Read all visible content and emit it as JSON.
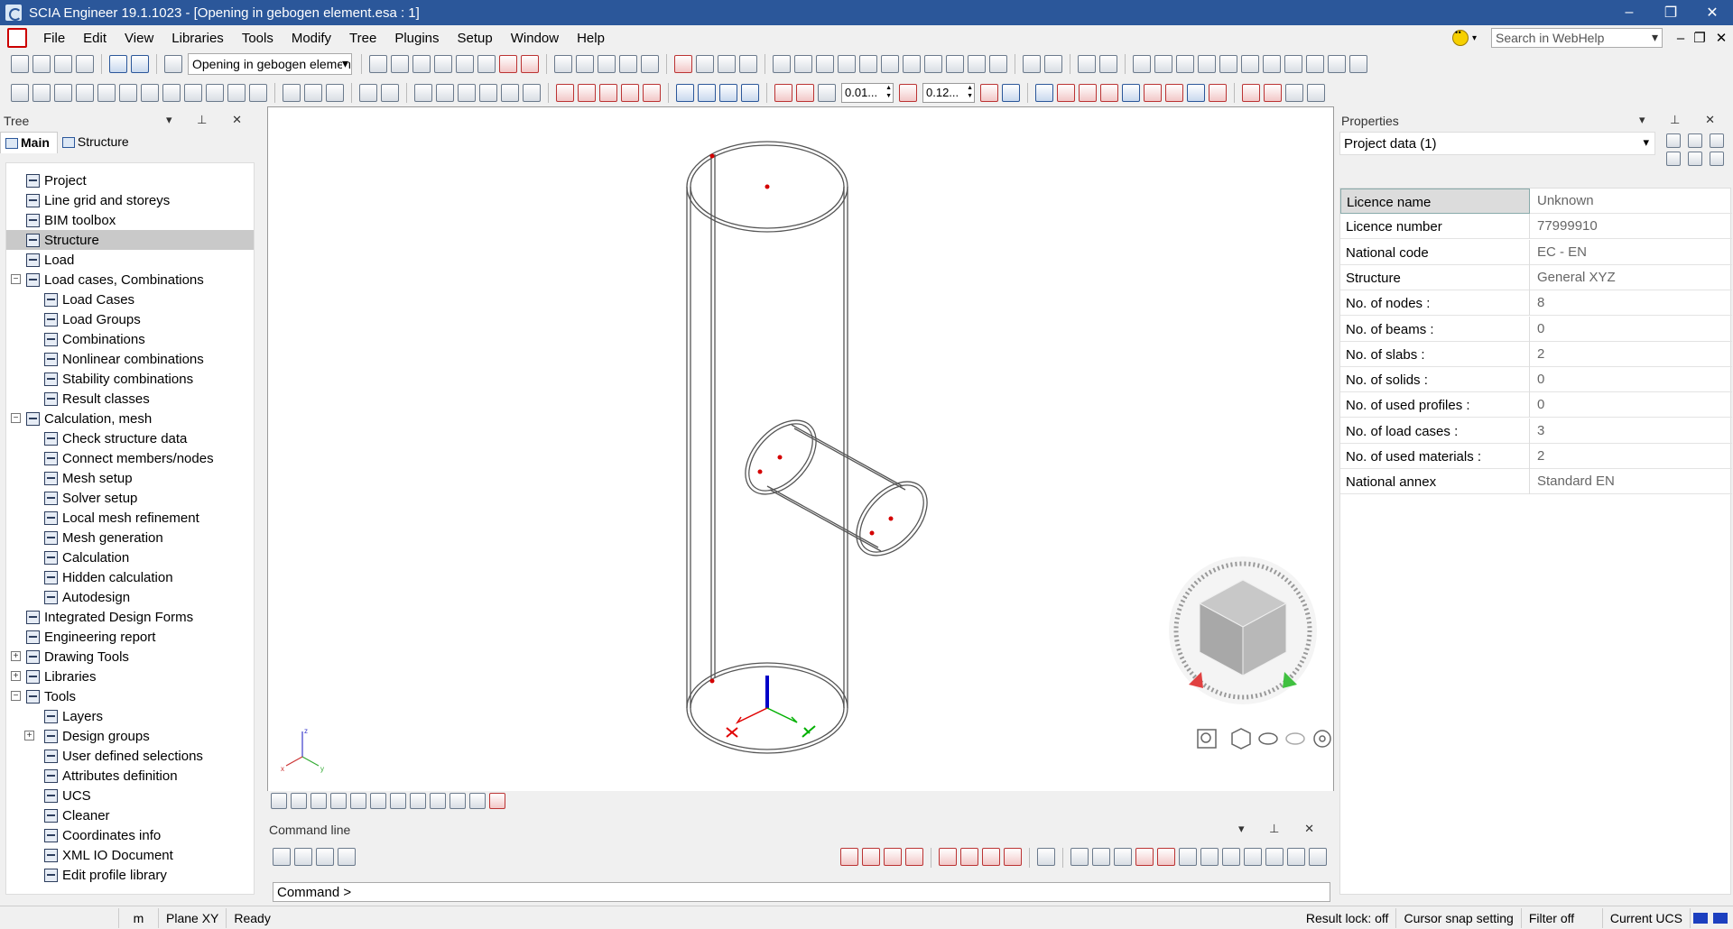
{
  "window": {
    "title": "SCIA Engineer 19.1.1023 - [Opening in gebogen element.esa : 1]",
    "minimize": "–",
    "restore": "❐",
    "close": "✕"
  },
  "menu": {
    "items": [
      "File",
      "Edit",
      "View",
      "Libraries",
      "Tools",
      "Modify",
      "Tree",
      "Plugins",
      "Setup",
      "Window",
      "Help"
    ],
    "search_placeholder": "Search in WebHelp",
    "mdi_min": "–",
    "mdi_restore": "❐",
    "mdi_close": "✕"
  },
  "toolbar": {
    "active_view": "Opening in gebogen element",
    "spin1": "0.01...",
    "spin2": "0.12..."
  },
  "tree_panel": {
    "title": "Tree",
    "tabs": [
      "Main",
      "Structure"
    ],
    "items": [
      {
        "label": "Project",
        "level": 1
      },
      {
        "label": "Line grid and storeys",
        "level": 1
      },
      {
        "label": "BIM toolbox",
        "level": 1
      },
      {
        "label": "Structure",
        "level": 1,
        "selected": true
      },
      {
        "label": "Load",
        "level": 1
      },
      {
        "label": "Load cases, Combinations",
        "level": 1,
        "expander": "−"
      },
      {
        "label": "Load Cases",
        "level": 2
      },
      {
        "label": "Load Groups",
        "level": 2
      },
      {
        "label": "Combinations",
        "level": 2
      },
      {
        "label": "Nonlinear combinations",
        "level": 2
      },
      {
        "label": "Stability combinations",
        "level": 2
      },
      {
        "label": "Result classes",
        "level": 2
      },
      {
        "label": "Calculation, mesh",
        "level": 1,
        "expander": "−"
      },
      {
        "label": "Check structure data",
        "level": 2
      },
      {
        "label": "Connect members/nodes",
        "level": 2
      },
      {
        "label": "Mesh setup",
        "level": 2
      },
      {
        "label": "Solver setup",
        "level": 2
      },
      {
        "label": "Local mesh refinement",
        "level": 2
      },
      {
        "label": "Mesh generation",
        "level": 2
      },
      {
        "label": "Calculation",
        "level": 2
      },
      {
        "label": "Hidden calculation",
        "level": 2
      },
      {
        "label": "Autodesign",
        "level": 2
      },
      {
        "label": "Integrated Design Forms",
        "level": 1
      },
      {
        "label": "Engineering report",
        "level": 1
      },
      {
        "label": "Drawing Tools",
        "level": 1,
        "expander": "+"
      },
      {
        "label": "Libraries",
        "level": 1,
        "expander": "+"
      },
      {
        "label": "Tools",
        "level": 1,
        "expander": "−"
      },
      {
        "label": "Layers",
        "level": 2
      },
      {
        "label": "Design groups",
        "level": 2,
        "expander": "+"
      },
      {
        "label": "User defined selections",
        "level": 2
      },
      {
        "label": "Attributes definition",
        "level": 2
      },
      {
        "label": "UCS",
        "level": 2
      },
      {
        "label": "Cleaner",
        "level": 2
      },
      {
        "label": "Coordinates info",
        "level": 2
      },
      {
        "label": "XML IO Document",
        "level": 2
      },
      {
        "label": "Edit profile library",
        "level": 2
      }
    ]
  },
  "viewport": {
    "axis_labels": {
      "x": "x",
      "y": "y",
      "z": "z"
    }
  },
  "command_line": {
    "title": "Command line",
    "prompt": "Command >"
  },
  "properties_panel": {
    "title": "Properties",
    "selection": "Project data (1)",
    "rows": [
      {
        "label": "Licence name",
        "value": "Unknown",
        "selected": true
      },
      {
        "label": "Licence number",
        "value": "77999910"
      },
      {
        "label": "National code",
        "value": "EC - EN"
      },
      {
        "label": "Structure",
        "value": "General XYZ"
      },
      {
        "label": "No. of nodes :",
        "value": "8"
      },
      {
        "label": "No. of beams :",
        "value": "0"
      },
      {
        "label": "No. of slabs :",
        "value": "2"
      },
      {
        "label": "No. of solids :",
        "value": "0"
      },
      {
        "label": "No. of used profiles :",
        "value": "0"
      },
      {
        "label": "No. of load cases :",
        "value": "3"
      },
      {
        "label": "No. of used materials :",
        "value": "2"
      },
      {
        "label": "National annex",
        "value": "Standard EN"
      }
    ]
  },
  "statusbar": {
    "unit": "m",
    "plane": "Plane XY",
    "state": "Ready",
    "result_lock": "Result lock: off",
    "cursor_snap": "Cursor snap setting",
    "filter": "Filter off",
    "ucs": "Current UCS"
  },
  "colors": {
    "titlebar": "#2b579a",
    "node": "#d40000",
    "axis_x": "#e00000",
    "axis_y": "#00b000",
    "axis_z": "#0000c8"
  }
}
